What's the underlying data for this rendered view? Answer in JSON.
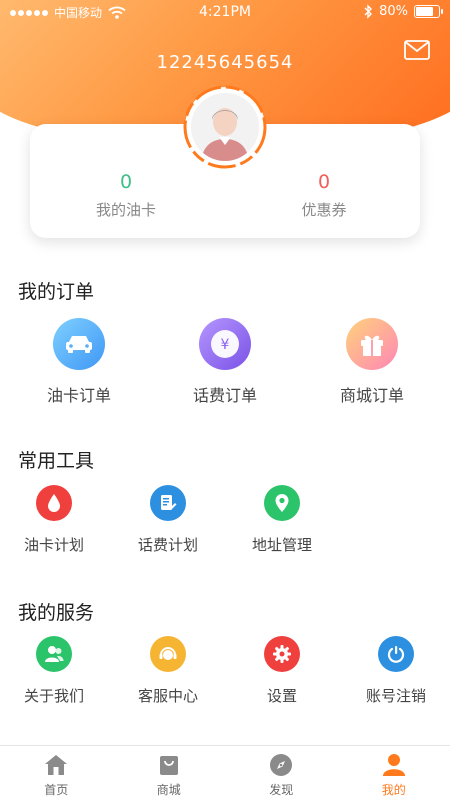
{
  "status_bar": {
    "carrier": "中国移动",
    "time": "4:21PM",
    "battery_text": "80%",
    "battery_level": 0.8
  },
  "profile": {
    "phone": "12245645654",
    "oil_card_count": "0",
    "oil_card_label": "我的油卡",
    "coupon_count": "0",
    "coupon_label": "优惠券"
  },
  "orders": {
    "title": "我的订单",
    "items": [
      {
        "label": "油卡订单",
        "icon": "car-icon"
      },
      {
        "label": "话费订单",
        "icon": "yen-coin-icon"
      },
      {
        "label": "商城订单",
        "icon": "gift-icon"
      }
    ]
  },
  "tools": {
    "title": "常用工具",
    "items": [
      {
        "label": "油卡计划",
        "icon": "oil-drop-icon",
        "color": "#f0403e"
      },
      {
        "label": "话费计划",
        "icon": "document-edit-icon",
        "color": "#2c8fe0"
      },
      {
        "label": "地址管理",
        "icon": "location-pin-icon",
        "color": "#2cc46a"
      }
    ]
  },
  "services": {
    "title": "我的服务",
    "items": [
      {
        "label": "关于我们",
        "icon": "people-icon",
        "color": "#2cc46a"
      },
      {
        "label": "客服中心",
        "icon": "headset-icon",
        "color": "#f5b533"
      },
      {
        "label": "设置",
        "icon": "gear-icon",
        "color": "#f0403e"
      },
      {
        "label": "账号注销",
        "icon": "power-icon",
        "color": "#2c8fe0"
      }
    ]
  },
  "tab_bar": {
    "active_color": "#ff7a1c",
    "items": [
      {
        "label": "首页",
        "icon": "home-icon"
      },
      {
        "label": "商城",
        "icon": "shopping-bag-icon"
      },
      {
        "label": "发现",
        "icon": "compass-icon"
      },
      {
        "label": "我的",
        "icon": "person-icon",
        "active": true
      }
    ]
  }
}
